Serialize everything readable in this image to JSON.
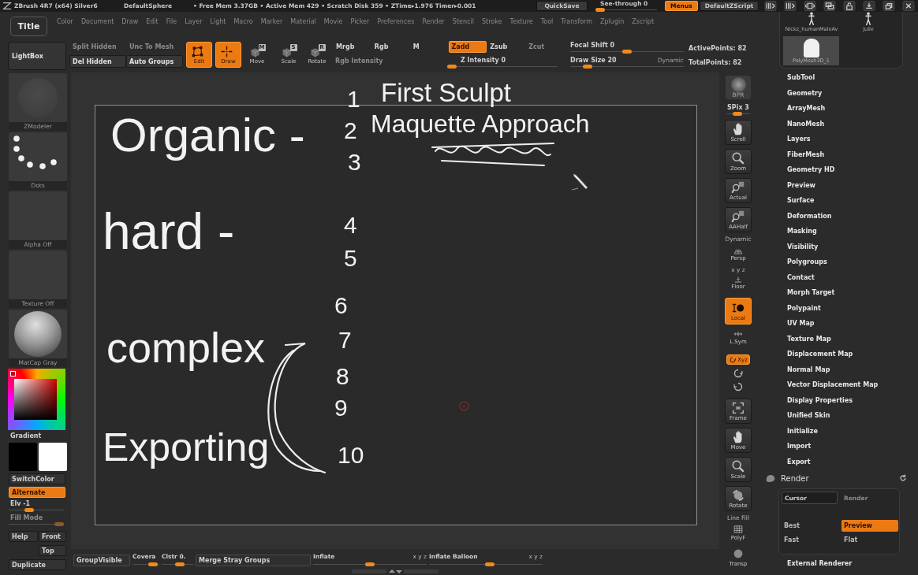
{
  "title_bar": {
    "app": "ZBrush 4R7 (x64) Silver6",
    "document": "DefaultSphere",
    "stats": "• Free Mem 3.37GB • Active Mem 429 • Scratch Disk 359 • ZTime▸1.976 Timer▸0.001",
    "quicksave": "QuickSave",
    "see_through": {
      "label": "See-through 0",
      "level": 0
    },
    "menus": {
      "label": "Menus",
      "on": true
    },
    "script": "DefaultZScript"
  },
  "menu_bar": {
    "tooltip": "Title",
    "items": [
      "Color",
      "Document",
      "Draw",
      "Edit",
      "File",
      "Layer",
      "Light",
      "Macro",
      "Marker",
      "Material",
      "Movie",
      "Picker",
      "Preferences",
      "Render",
      "Stencil",
      "Stroke",
      "Texture",
      "Tool",
      "Transform",
      "Zplugin",
      "Zscript"
    ]
  },
  "shelf": {
    "lightbox": "LightBox",
    "geometry": [
      {
        "label": "Split Hidden",
        "disabled": true
      },
      {
        "label": "Unc To Mesh",
        "disabled": true
      },
      {
        "label": "Del Hidden",
        "disabled": false
      },
      {
        "label": "Auto Groups",
        "disabled": false
      }
    ],
    "transform": [
      {
        "kind": "edit",
        "label": "Edit",
        "on": true
      },
      {
        "kind": "draw",
        "label": "Draw",
        "on": true
      },
      {
        "kind": "move",
        "label": "Move",
        "key": "M",
        "on": false
      },
      {
        "kind": "scale",
        "label": "Scale",
        "key": "S",
        "on": false
      },
      {
        "kind": "rotate",
        "label": "Rotate",
        "key": "R",
        "on": false
      }
    ],
    "channels": [
      {
        "label": "Mrgb",
        "selected": false,
        "disabled": false
      },
      {
        "label": "Rgb",
        "selected": false,
        "disabled": false
      },
      {
        "label": "M",
        "selected": false,
        "disabled": false
      },
      {
        "label": "Zadd",
        "selected": true,
        "disabled": false
      },
      {
        "label": "Zsub",
        "selected": false,
        "disabled": false
      },
      {
        "label": "Zcut",
        "selected": false,
        "disabled": true
      }
    ],
    "rgb_intensity": {
      "label": "Rgb Intensity",
      "disabled": true
    },
    "z_intensity": {
      "label": "Z Intensity 0",
      "level": 0
    },
    "focal_shift": {
      "label": "Focal Shift 0",
      "level": 0.5
    },
    "draw_size": {
      "label": "Draw Size 20",
      "level": 0.12
    },
    "dynamic": "Dynamic",
    "points": [
      "ActivePoints: 82",
      "TotalPoints: 82"
    ]
  },
  "left_panel": {
    "pickers": [
      {
        "kind": "brush",
        "label": "ZModeler"
      },
      {
        "kind": "stroke",
        "label": "Dots"
      },
      {
        "kind": "alpha",
        "label": "Alpha Off"
      },
      {
        "kind": "texture",
        "label": "Texture Off"
      },
      {
        "kind": "material",
        "label": "MatCap Gray"
      }
    ],
    "gradient": "Gradient",
    "swatches": [
      {
        "color": "#000000"
      },
      {
        "color": "#ffffff"
      }
    ],
    "switch_color": "SwitchColor",
    "alternate": {
      "label": "Alternate",
      "on": true
    },
    "sliders": [
      {
        "label": "Elv -1",
        "level": 0.35,
        "disabled": false
      },
      {
        "label": "Fill Mode",
        "level": 1,
        "disabled": true
      }
    ],
    "views": [
      "Help",
      "Front",
      "Top",
      "Duplicate"
    ]
  },
  "canvas": {
    "notes": [
      "Organic -",
      "hard -",
      "complex",
      "Exporting",
      "First Sculpt",
      "Maquette Approach"
    ],
    "numbers": [
      "1",
      "2",
      "3",
      "4",
      "5",
      "6",
      "7",
      "8",
      "9",
      "10"
    ]
  },
  "view_tools": {
    "bpr": "BPR",
    "spix": {
      "label": "SPix 3",
      "level": 0.45
    },
    "buttons": [
      {
        "kind": "scroll",
        "label": "Scroll",
        "on": false
      },
      {
        "kind": "zoom",
        "label": "Zoom",
        "on": false
      },
      {
        "kind": "actual",
        "label": "Actual",
        "on": false
      },
      {
        "kind": "aahalf",
        "label": "AAHalf",
        "on": false
      },
      {
        "kind": "persp",
        "label": "Persp",
        "caption": "Dynamic",
        "on": false
      },
      {
        "kind": "floor",
        "label": "Floor",
        "caption": "x y z",
        "on": false
      },
      {
        "kind": "local",
        "label": "Local",
        "on": true
      },
      {
        "kind": "lsym",
        "label": "L.Sym",
        "on": false
      },
      {
        "kind": "xyz",
        "label": "Xyz",
        "on": true
      },
      {
        "kind": "frame",
        "label": "Frame",
        "on": false
      },
      {
        "kind": "pan",
        "label": "Move",
        "on": false
      },
      {
        "kind": "zoom3d",
        "label": "Scale",
        "on": false
      },
      {
        "kind": "rotate3d",
        "label": "Rotate",
        "on": false
      },
      {
        "kind": "polyf",
        "label": "PolyF",
        "caption": "Line Fill",
        "on": false
      },
      {
        "kind": "transp",
        "label": "Transp",
        "on": false
      }
    ]
  },
  "tool_panel": {
    "tools": [
      {
        "kind": "figure",
        "label": "Nickz_humanMaleAv"
      },
      {
        "kind": "figure",
        "label": "Julie"
      },
      {
        "kind": "polymesh",
        "label": "PolyMesh3D_1"
      }
    ],
    "palettes": [
      "SubTool",
      "Geometry",
      "ArrayMesh",
      "NanoMesh",
      "Layers",
      "FiberMesh",
      "Geometry HD",
      "Preview",
      "Surface",
      "Deformation",
      "Masking",
      "Visibility",
      "Polygroups",
      "Contact",
      "Morph Target",
      "Polypaint",
      "UV Map",
      "Texture Map",
      "Displacement Map",
      "Normal Map",
      "Vector Displacement Map",
      "Display Properties",
      "Unified Skin",
      "Initialize",
      "Import",
      "Export"
    ],
    "render": {
      "title": "Render",
      "buttons": [
        {
          "label": "Cursor",
          "disabled": false
        },
        {
          "label": "Render",
          "disabled": true
        }
      ],
      "modes": [
        {
          "label": "Best",
          "selected": false
        },
        {
          "label": "Preview",
          "selected": true
        },
        {
          "label": "Fast",
          "selected": false
        },
        {
          "label": "Flat",
          "selected": false
        }
      ],
      "external": "External Renderer"
    }
  },
  "bottom_bar": [
    {
      "kind": "button",
      "label": "GroupVisible"
    },
    {
      "kind": "slider",
      "label": "Covera",
      "level": 0.9
    },
    {
      "kind": "slider",
      "label": "Clstr 0.",
      "level": 0.6
    },
    {
      "kind": "button",
      "label": "Merge Stray Groups"
    },
    {
      "kind": "slider",
      "label": "Inflate",
      "level": 0.5,
      "axes": "x y z"
    },
    {
      "kind": "slider",
      "label": "Inflate Balloon",
      "level": 0.54,
      "axes": "x y z"
    }
  ]
}
